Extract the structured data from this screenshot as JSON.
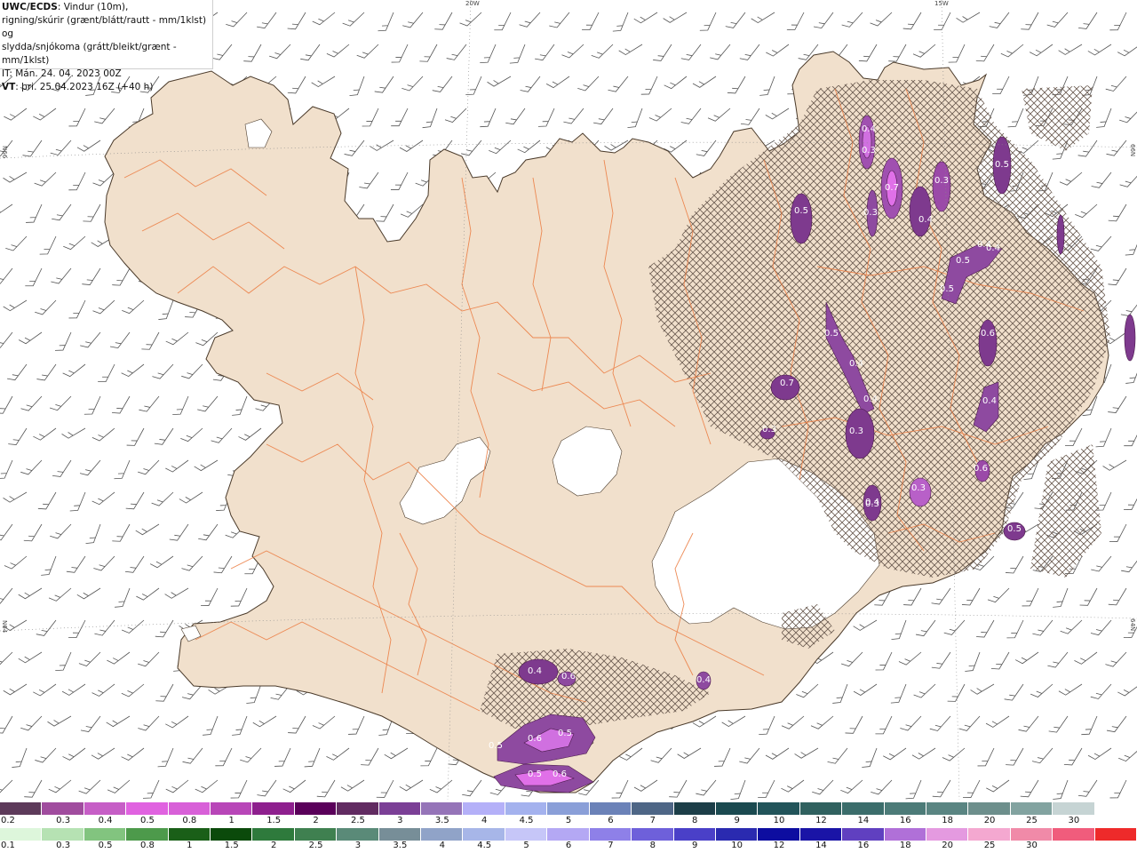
{
  "header": {
    "product": "UWC/ECDS",
    "line1_rest": ": Vindur (10m),",
    "line2": "rigning/skúrir (grænt/blátt/rautt - mm/1klst) og",
    "line3": "slydda/snjókoma (grátt/bleikt/grænt - mm/1klst)",
    "line4": "IT: Mán. 24. 04. 2023 00Z",
    "vt_label": "VT",
    "vt_rest": ": þri. 25.04.2023 16Z (+40 h)"
  },
  "graticule": {
    "top_left": "20W",
    "top_right": "15W",
    "left_upper": "N66",
    "left_lower": "N64",
    "right_upper": "66N",
    "right_lower": "64N"
  },
  "precip_labels": [
    "0.4",
    "0.3",
    "0.5",
    "0.3",
    "0.7",
    "0.3",
    "0.4",
    "0.5",
    "0.5",
    "0.4",
    "0.4",
    "0.5",
    "0.6",
    "0.5",
    "0.4",
    "0.4",
    "0.3",
    "0.4",
    "0.3",
    "0.5",
    "0.7",
    "0.3",
    "0.6",
    "0.4",
    "0.3",
    "0.4",
    "0.6",
    "0.4",
    "0.5",
    "0.5",
    "0.5",
    "0.6",
    "0.6"
  ],
  "legend_snow": {
    "colors": [
      "#5d3a5a",
      "#a04c9e",
      "#c65ec6",
      "#e062e0",
      "#d860d8",
      "#b846b8",
      "#8e1f8e",
      "#5a005a",
      "#612b61",
      "#7b3f96",
      "#9574b8",
      "#b4b0f8",
      "#a4b2ee",
      "#8a9fd8",
      "#6b82b8",
      "#4e6686",
      "#1c3e48",
      "#1b4a50",
      "#22545a",
      "#30615f",
      "#3b6d6b",
      "#4c7b78",
      "#5a8582",
      "#6d8f8c",
      "#82a3a0",
      "#c6d4d4",
      "#ffffff"
    ],
    "labels": [
      "0.2",
      "0.3",
      "0.4",
      "0.5",
      "0.8",
      "1",
      "1.5",
      "2",
      "2.5",
      "3",
      "3.5",
      "4",
      "4.5",
      "5",
      "6",
      "7",
      "8",
      "9",
      "10",
      "12",
      "14",
      "16",
      "18",
      "20",
      "25",
      "30"
    ]
  },
  "legend_rain": {
    "colors": [
      "#ddf6db",
      "#b6e2b3",
      "#82c47f",
      "#4d9a4b",
      "#1a5f18",
      "#0b4a0b",
      "#2e7a3c",
      "#3f8050",
      "#5a8a78",
      "#778e98",
      "#90a3c8",
      "#a7b6e8",
      "#c6c6f8",
      "#b4a8f4",
      "#8e80e8",
      "#6e60da",
      "#4a40c8",
      "#2a2ab0",
      "#0d0da0",
      "#1a14a6",
      "#6040c0",
      "#b070d8",
      "#e49ae0",
      "#f4a8d0",
      "#f08aa8",
      "#f05c7c",
      "#ee2a2a"
    ],
    "labels": [
      "0.1",
      "0.3",
      "0.5",
      "0.8",
      "1",
      "1.5",
      "2",
      "2.5",
      "3",
      "3.5",
      "4",
      "4.5",
      "5",
      "6",
      "7",
      "8",
      "9",
      "10",
      "12",
      "14",
      "16",
      "18",
      "20",
      "25",
      "30"
    ]
  },
  "colors": {
    "land": "#f1e0cc",
    "coast": "#5a4a3a",
    "roads": "#ec7f45",
    "glacier": "#ffffff",
    "barb": "#4a4a4a",
    "sea": "#ffffff"
  }
}
